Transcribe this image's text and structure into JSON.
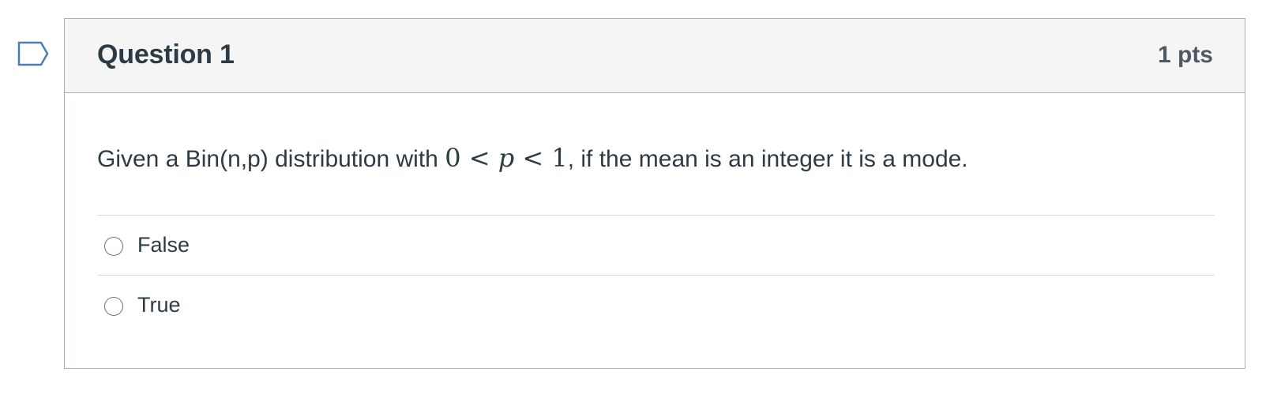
{
  "question": {
    "title": "Question 1",
    "points": "1 pts",
    "text_before": "Given a Bin(n,p) distribution with ",
    "math": {
      "left": "0",
      "op1": "<",
      "var": "p",
      "op2": "<",
      "right": "1"
    },
    "text_after": ", if the mean is an integer it is a mode."
  },
  "answers": [
    {
      "label": "False",
      "selected": false
    },
    {
      "label": "True",
      "selected": false
    }
  ],
  "icons": {
    "flag": "flag-outline-icon"
  },
  "colors": {
    "header_bg": "#f5f5f5",
    "border": "#a5afb5",
    "text": "#2d3b45",
    "flag": "#4a7fb0"
  }
}
